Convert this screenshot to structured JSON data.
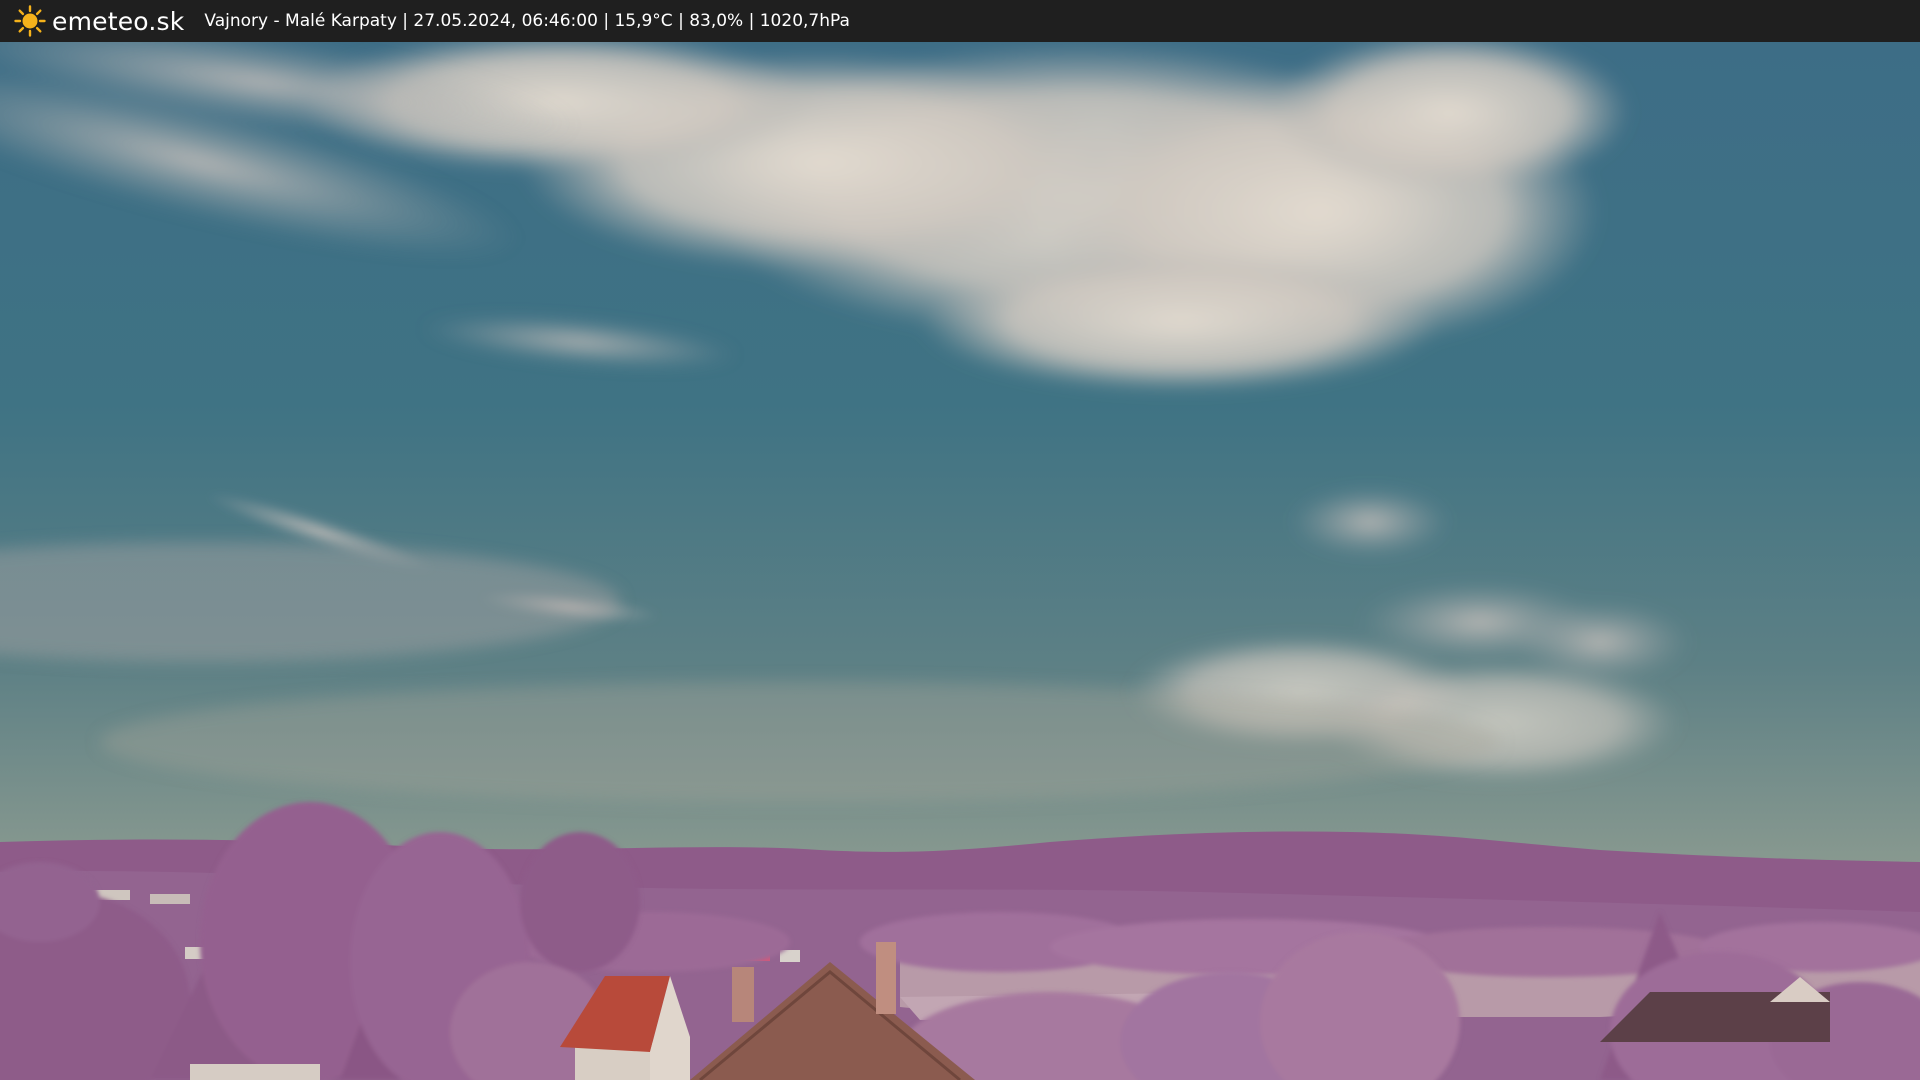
{
  "header": {
    "logo_icon": "sun-icon",
    "brand": "emeteo.sk",
    "caption": "Vajnory - Malé Karpaty | 27.05.2024, 06:46:00 | 15,9°C | 83,0% | 1020,7hPa"
  },
  "colors": {
    "bar_bg": "#1f1f1f",
    "sun": "#f5b21b",
    "sky_top": "#3f7088",
    "sky_horizon": "#8a9a90",
    "foliage": "#9a6a95",
    "roof_red": "#b84a3a"
  }
}
